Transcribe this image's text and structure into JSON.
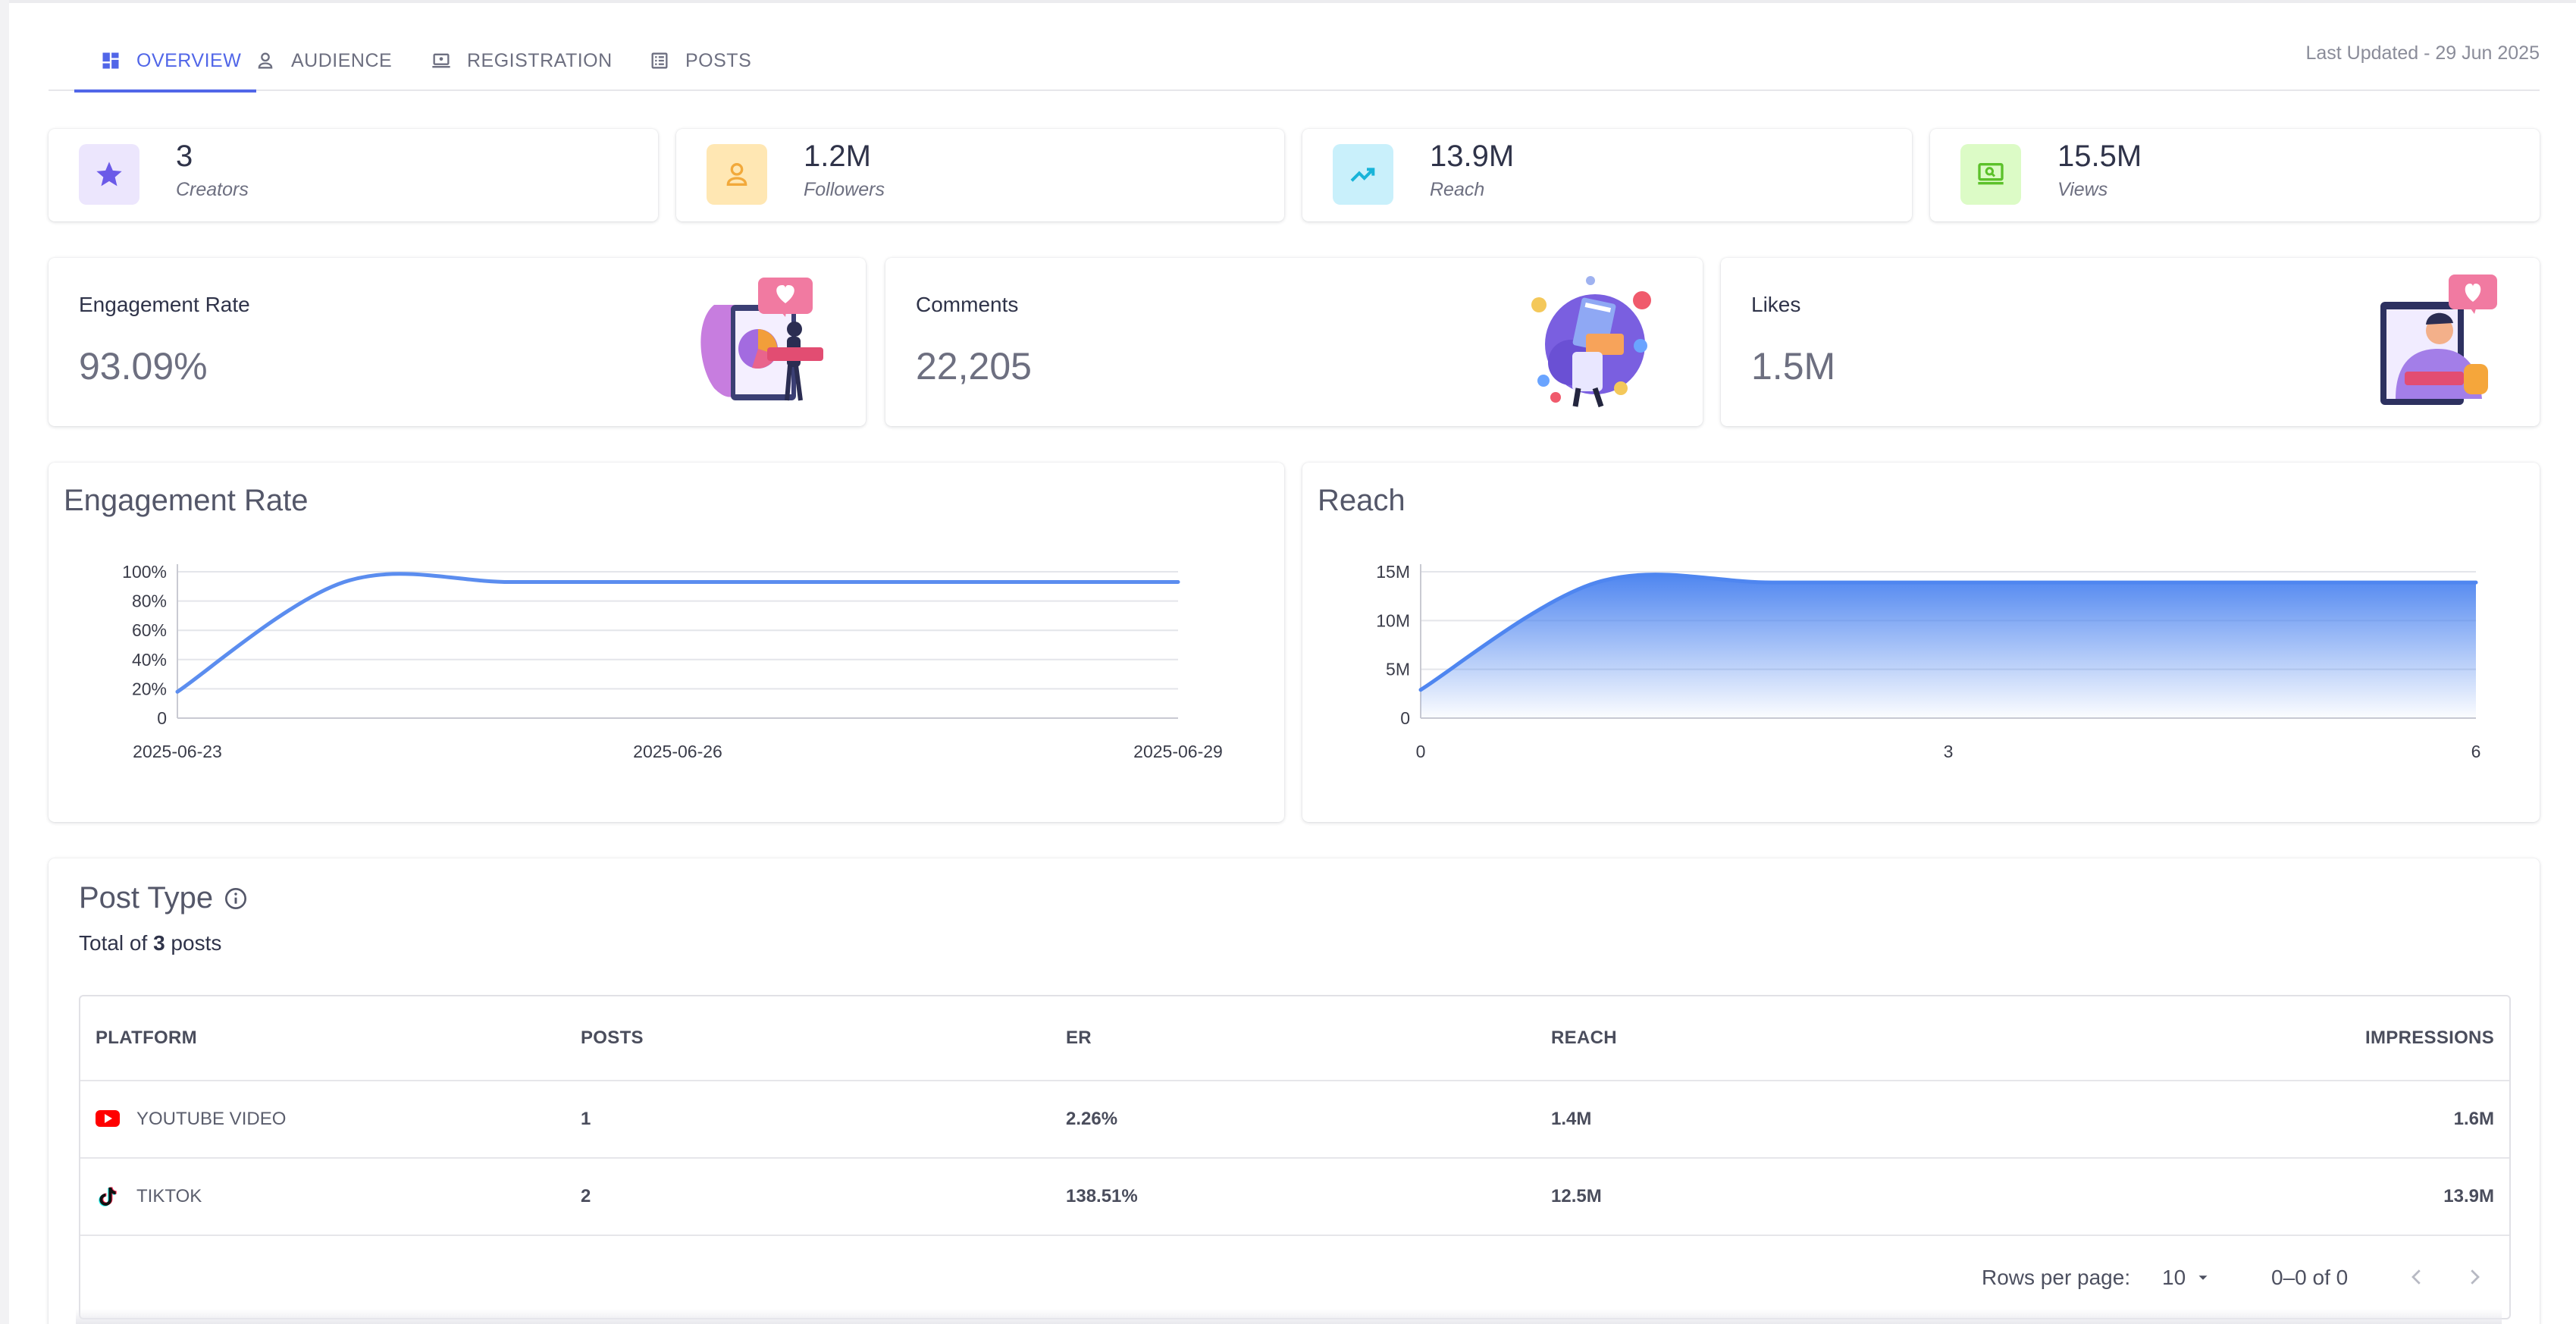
{
  "tabs": [
    {
      "label": "OVERVIEW",
      "icon": "dashboard-icon",
      "active": true
    },
    {
      "label": "AUDIENCE",
      "icon": "person-icon"
    },
    {
      "label": "REGISTRATION",
      "icon": "laptop-icon"
    },
    {
      "label": "POSTS",
      "icon": "list-icon"
    }
  ],
  "last_updated": "Last Updated - 29 Jun 2025",
  "stats": [
    {
      "value": "3",
      "label": "Creators",
      "icon": "star-icon",
      "bg": "#ece6fd",
      "fg": "#6b5ae8"
    },
    {
      "value": "1.2M",
      "label": "Followers",
      "icon": "person-icon",
      "bg": "#ffe7b3",
      "fg": "#f2a93b"
    },
    {
      "value": "13.9M",
      "label": "Reach",
      "icon": "trending-up-icon",
      "bg": "#c9f0fb",
      "fg": "#18b4d9"
    },
    {
      "value": "15.5M",
      "label": "Views",
      "icon": "monitor-search-icon",
      "bg": "#dcfbc6",
      "fg": "#5cc12a"
    }
  ],
  "kpis": [
    {
      "title": "Engagement Rate",
      "value": "93.09%",
      "illustration": "engagement-illustration"
    },
    {
      "title": "Comments",
      "value": "22,205",
      "illustration": "comments-illustration"
    },
    {
      "title": "Likes",
      "value": "1.5M",
      "illustration": "likes-illustration"
    }
  ],
  "chart_data": [
    {
      "type": "line",
      "title": "Engagement Rate",
      "x": [
        "2025-06-23",
        "2025-06-24",
        "2025-06-25",
        "2025-06-26",
        "2025-06-27",
        "2025-06-28",
        "2025-06-29"
      ],
      "x_ticks": [
        "2025-06-23",
        "2025-06-26",
        "2025-06-29"
      ],
      "series": [
        {
          "values": [
            18,
            93,
            93,
            93,
            93,
            93,
            93
          ]
        }
      ],
      "y_ticks": [
        "0",
        "20%",
        "40%",
        "60%",
        "80%",
        "100%"
      ],
      "ylim": [
        0,
        100
      ],
      "grid": true,
      "color": "#5b8def"
    },
    {
      "type": "area",
      "title": "Reach",
      "x": [
        0,
        1,
        2,
        3,
        4,
        5,
        6
      ],
      "x_ticks": [
        "0",
        "3",
        "6"
      ],
      "series": [
        {
          "values": [
            2.9,
            13.9,
            13.9,
            13.9,
            13.9,
            13.9,
            13.9
          ]
        }
      ],
      "y_ticks": [
        "0",
        "5M",
        "10M",
        "15M"
      ],
      "ylim": [
        0,
        15
      ],
      "grid": true,
      "color": "#4f86f0"
    }
  ],
  "post_type": {
    "title": "Post Type",
    "total_prefix": "Total of",
    "total": "3",
    "total_suffix": "posts",
    "columns": [
      "PLATFORM",
      "POSTS",
      "ER",
      "REACH",
      "IMPRESSIONS"
    ],
    "rows": [
      {
        "platform": "YOUTUBE VIDEO",
        "icon": "youtube-icon",
        "posts": "1",
        "er": "2.26%",
        "reach": "1.4M",
        "impressions": "1.6M"
      },
      {
        "platform": "TIKTOK",
        "icon": "tiktok-icon",
        "posts": "2",
        "er": "138.51%",
        "reach": "12.5M",
        "impressions": "13.9M"
      }
    ],
    "pagination": {
      "rows_per_page_label": "Rows per page:",
      "rows_per_page": "10",
      "range": "0–0 of 0"
    }
  }
}
